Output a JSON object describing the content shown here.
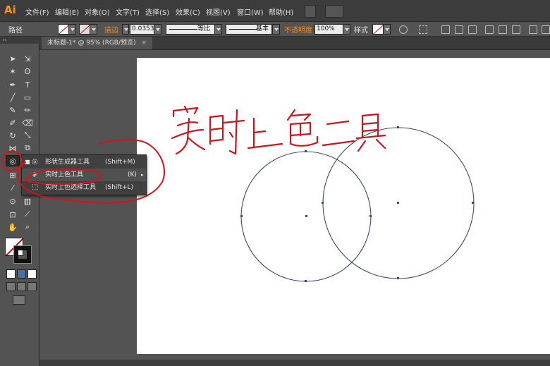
{
  "app": {
    "logo": "Ai"
  },
  "menu": [
    "文件(F)",
    "编辑(E)",
    "对象(O)",
    "文字(T)",
    "选择(S)",
    "效果(C)",
    "视图(V)",
    "窗口(W)",
    "帮助(H)"
  ],
  "control_bar": {
    "object_type": "路径",
    "stroke_label": "描边",
    "stroke_value": "0.0353",
    "profile_label": "等比",
    "brush_label": "基本",
    "opacity_label": "不透明度",
    "opacity_value": "100%",
    "style_label": "样式"
  },
  "document_tab": {
    "title": "未标题-1* @ 95% (RGB/预览)",
    "close": "×"
  },
  "tools_panel": {
    "grip": "‹‹"
  },
  "flyout": {
    "items": [
      {
        "bullet": "■",
        "name": "形状生成器工具",
        "shortcut": "(Shift+M)",
        "icon": "shape-builder-icon"
      },
      {
        "bullet": "",
        "name": "实时上色工具",
        "shortcut": "(K)",
        "icon": "live-paint-bucket-icon"
      },
      {
        "bullet": "",
        "name": "实时上色选择工具",
        "shortcut": "(Shift+L)",
        "icon": "live-paint-selection-icon"
      }
    ],
    "arrow": "▸"
  },
  "annotation": {
    "handwritten_text": "实时上色工具",
    "color": "#d0141c"
  },
  "colors": {
    "accent": "#f7941d",
    "annotation": "#d0141c",
    "circle_stroke": "#3d4a6e"
  }
}
